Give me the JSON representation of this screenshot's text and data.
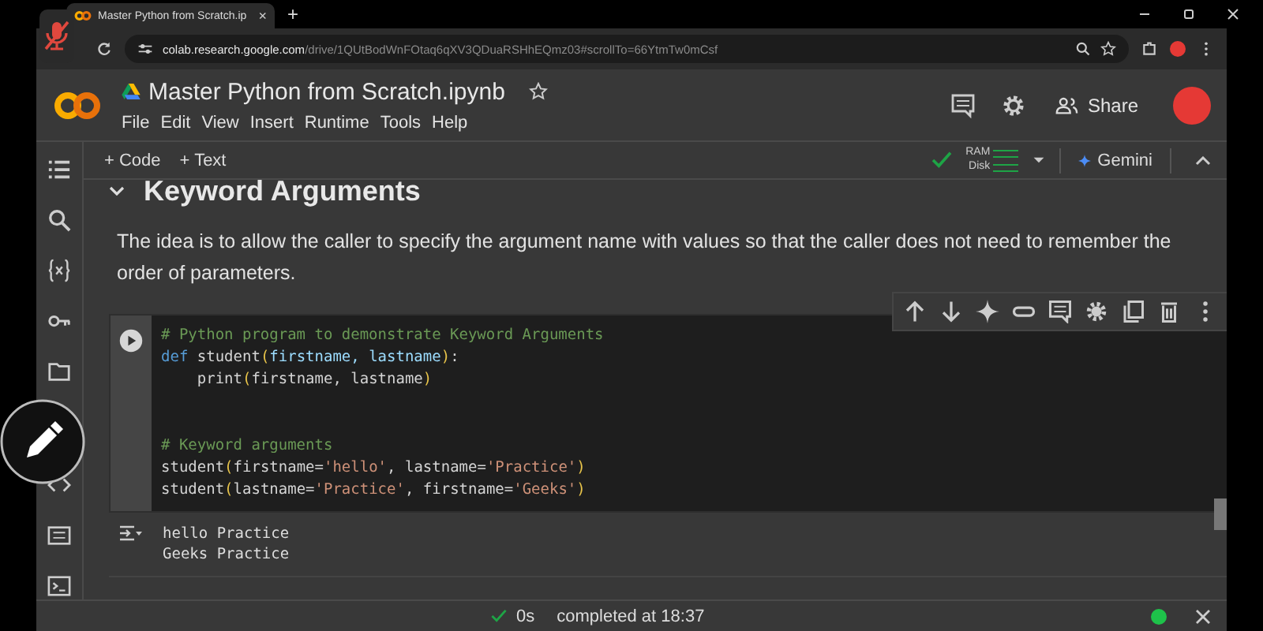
{
  "browser": {
    "tab_title": "Master Python from Scratch.ip",
    "tab_close": "×",
    "new_tab": "+",
    "url_host": "colab.research.google.com",
    "url_path": "/drive/1QUtBodWnFOtaq6qXV3QDuaRSHhEQmz03#scrollTo=66YtmTw0mCsf"
  },
  "header": {
    "title": "Master Python from Scratch.ipynb",
    "menu": [
      "File",
      "Edit",
      "View",
      "Insert",
      "Runtime",
      "Tools",
      "Help"
    ],
    "share": "Share"
  },
  "toolbar": {
    "add": [
      "+ Code",
      "+ Text"
    ],
    "ram": "RAM",
    "disk": "Disk",
    "gemini": "Gemini"
  },
  "section": {
    "heading": "Keyword Arguments",
    "expanded": true
  },
  "paragraph": "The idea is to allow the caller to specify the argument name with values so that the caller does not need to remember the order of parameters.",
  "code_cell": {
    "blocks": [
      [
        [
          {
            "kind": "comment",
            "text": "# Python program to demonstrate Keyword Arguments"
          }
        ],
        [
          {
            "kind": "keyword",
            "text": "def"
          },
          {
            "kind": "plain",
            "text": " student"
          },
          {
            "kind": "paren",
            "text": "("
          },
          {
            "kind": "param",
            "text": "firstname, lastname"
          },
          {
            "kind": "paren",
            "text": ")"
          },
          {
            "kind": "plain",
            "text": ":"
          }
        ],
        [
          {
            "kind": "plain",
            "text": "    print"
          },
          {
            "kind": "paren",
            "text": "("
          },
          {
            "kind": "plain",
            "text": "firstname, lastname"
          },
          {
            "kind": "paren",
            "text": ")"
          }
        ]
      ],
      [
        [
          {
            "kind": "comment",
            "text": "# Keyword arguments"
          }
        ],
        [
          {
            "kind": "plain",
            "text": "student"
          },
          {
            "kind": "paren",
            "text": "("
          },
          {
            "kind": "plain",
            "text": "firstname="
          },
          {
            "kind": "string",
            "text": "'hello'"
          },
          {
            "kind": "plain",
            "text": ", lastname="
          },
          {
            "kind": "string",
            "text": "'Practice'"
          },
          {
            "kind": "paren",
            "text": ")"
          }
        ],
        [
          {
            "kind": "plain",
            "text": "student"
          },
          {
            "kind": "paren",
            "text": "("
          },
          {
            "kind": "plain",
            "text": "lastname="
          },
          {
            "kind": "string",
            "text": "'Practice'"
          },
          {
            "kind": "plain",
            "text": ", firstname="
          },
          {
            "kind": "string",
            "text": "'Geeks'"
          },
          {
            "kind": "paren",
            "text": ")"
          }
        ]
      ]
    ]
  },
  "output": [
    "hello Practice",
    "Geeks Practice"
  ],
  "status": {
    "duration": "0s",
    "message": "completed at 18:37",
    "connected": true
  }
}
